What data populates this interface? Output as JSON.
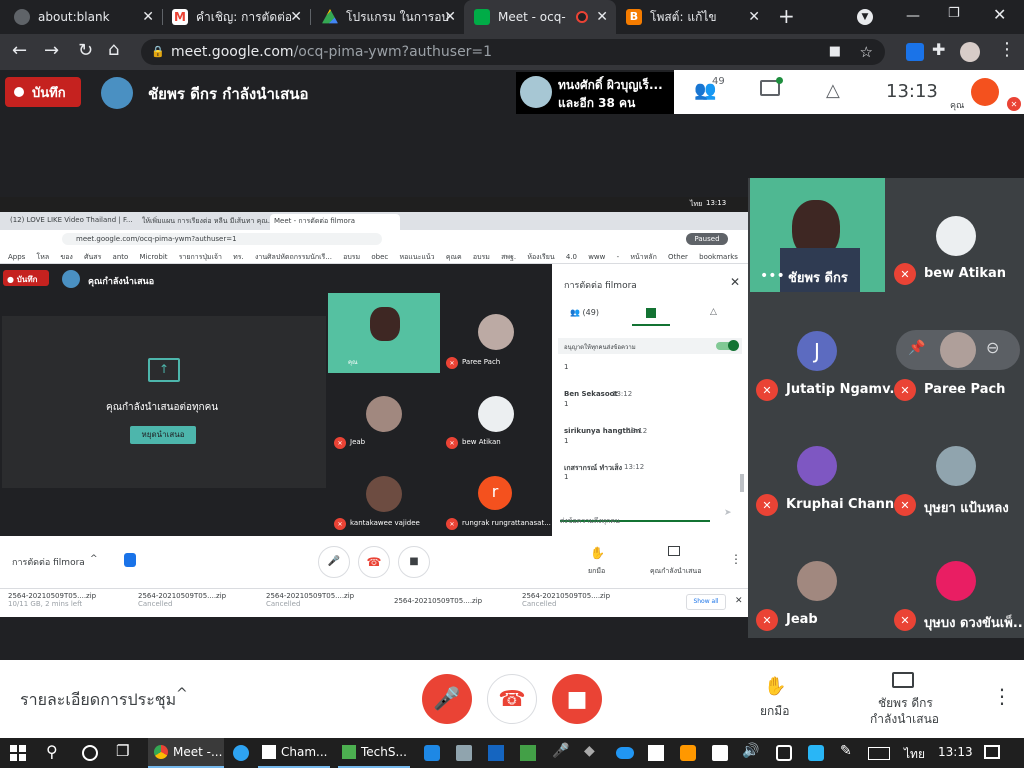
{
  "browser": {
    "tabs": [
      {
        "label": "about:blank",
        "color": "#5f6368"
      },
      {
        "label": "คำเชิญ: การตัดต่อ",
        "color": "#ea4335"
      },
      {
        "label": "โปรแกรม ในการอบ",
        "color": "#fbbc04"
      },
      {
        "label": "Meet - ocq-",
        "color": "#00ac47"
      },
      {
        "label": "โพสต์: แก้ไข",
        "color": "#f57c00"
      }
    ],
    "url_host": "meet.google.com",
    "url_path": "/ocq-pima-ywm?authuser=1"
  },
  "meet_top": {
    "record_label": "บันทึก",
    "presenter_text": "ชัยพร ดีกร กำลังนำเสนอ",
    "people_line1": "ทนงศักดิ์ ผิวบุญเร็...",
    "people_line2": "และอีก 38 คน",
    "participant_count": "49",
    "clock": "13:13",
    "you_label": "คุณ"
  },
  "inner": {
    "tabs": [
      "(12) LOVE LIKE Video Thailand | F...",
      "ให้เพิ่มแผน การเรียงต่อ หลีน มีเส้นทา คุณ...",
      "Meet - การตัดต่อ filmora"
    ],
    "url": "meet.google.com/ocq-pima-ywm?authuser=1",
    "paused": "Paused",
    "bookmarks": [
      "Apps",
      "โหล",
      "ของ ศันสร",
      "anto",
      "Microbit",
      "รายการปุ่มเจ้า ทร.",
      "งานศิลปหัตถกรรมนักเรี...",
      "อบรม obec",
      "หอแนะแน้ว คุณค",
      "อบรม สพฐ.",
      "ห้องเรียน 4.0",
      "www - หน้าหลัก",
      "Other bookmarks"
    ],
    "record_label": "บันทึก",
    "presenting": "คุณกำลังนำเสนอ",
    "presenting_center": "คุณกำลังนำเสนอต่อทุกคน",
    "stop_button": "หยุดนำเสนอ",
    "tiles": [
      {
        "name": "คุณ"
      },
      {
        "name": "Paree Pach"
      },
      {
        "name": "Jeab"
      },
      {
        "name": "bew Atikan"
      },
      {
        "name": "kantakawee vajidee"
      },
      {
        "name": "rungrak rungrattanasat..."
      }
    ],
    "r_initial": "r",
    "chat_title": "การตัดต่อ filmora",
    "people_count": "(49)",
    "allow_chat": "อนุญาตให้ทุกคนส่งข้อความ",
    "messages": [
      {
        "name": "",
        "time": "",
        "text": "1"
      },
      {
        "name": "Ben Sekasoot",
        "time": "13:12",
        "text": "1"
      },
      {
        "name": "sirikunya hangthim",
        "time": "13:12",
        "text": "1"
      },
      {
        "name": "เกสรากรณ์ ทำวเส็ง",
        "time": "13:12",
        "text": "1"
      }
    ],
    "chat_input_placeholder": "ส่งข้อความถึงทุกคน",
    "bottom_title": "การตัดต่อ filmora",
    "raise_hand": "ยกมือ",
    "you_present": "คุณกำลังนำเสนอ",
    "downloads": [
      {
        "name": "2564-20210509T05....zip",
        "status": "10/11 GB, 2 mins left"
      },
      {
        "name": "2564-20210509T05....zip",
        "status": "Cancelled"
      },
      {
        "name": "2564-20210509T05....zip",
        "status": "Cancelled"
      },
      {
        "name": "2564-20210509T05....zip",
        "status": ""
      },
      {
        "name": "2564-20210509T05....zip",
        "status": "Cancelled"
      }
    ],
    "show_all": "Show all",
    "taskbar_lang": "ไทย",
    "taskbar_time": "13:13"
  },
  "side_tiles": [
    {
      "name": "ชัยพร ดีกร"
    },
    {
      "name": "bew Atikan"
    },
    {
      "name": "Jutatip Ngamv...",
      "initial": "J"
    },
    {
      "name": "Paree Pach"
    },
    {
      "name": "Kruphai Channel"
    },
    {
      "name": "บุษยา แป้นหลง"
    },
    {
      "name": "Jeab"
    },
    {
      "name": "บุษบง ดวงขันเพ็..."
    }
  ],
  "bottom": {
    "details": "รายละเอียดการประชุม",
    "raise_hand": "ยกมือ",
    "presenter_line1": "ชัยพร ดีกร",
    "presenter_line2": "กำลังนำเสนอ"
  },
  "taskbar": {
    "items": [
      "Meet -...",
      "Cham...",
      "TechS..."
    ],
    "lang": "ไทย",
    "time": "13:13"
  },
  "colors": {
    "accent_red": "#ea4335",
    "meet_bg": "#202124",
    "chrome_dark": "#35363a",
    "green": "#2e7d5b",
    "teal": "#4db6ac"
  }
}
